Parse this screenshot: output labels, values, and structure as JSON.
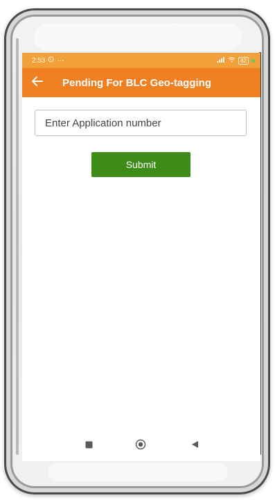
{
  "status_bar": {
    "time": "2:53",
    "left_icons": [
      "whatsapp-icon",
      "more-dots-icon"
    ],
    "right_icons": [
      "signal-icon",
      "wifi-icon",
      "battery-icon"
    ],
    "battery_text": "82"
  },
  "app_bar": {
    "title": "Pending For BLC Geo-tagging",
    "background": "#f07f22",
    "back_icon": "arrow-left-icon"
  },
  "form": {
    "application_placeholder": "Enter Application number",
    "application_value": "",
    "submit_label": "Submit",
    "submit_color": "#3d8b18"
  },
  "nav_bar": {
    "items": [
      "recents-square-icon",
      "home-circle-icon",
      "back-triangle-icon"
    ]
  }
}
